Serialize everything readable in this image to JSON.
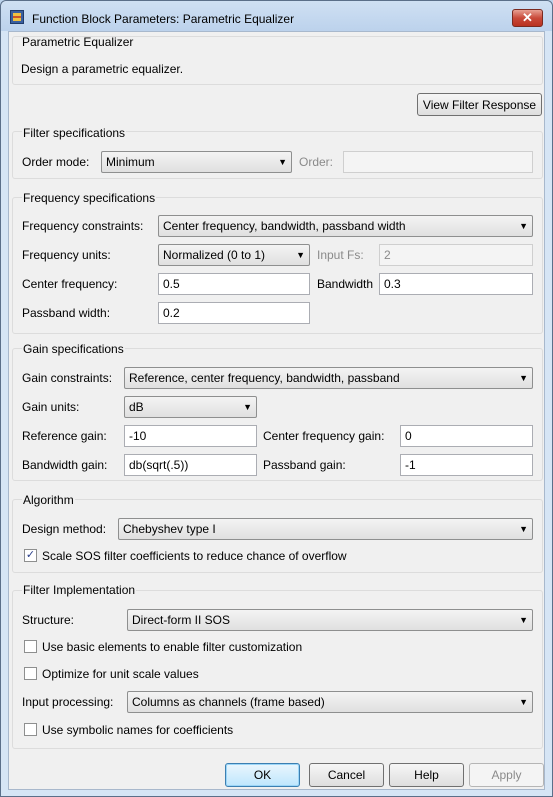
{
  "window": {
    "title": "Function Block Parameters: Parametric Equalizer",
    "close_glyph": "✕"
  },
  "block": {
    "name": "Parametric Equalizer",
    "description": "Design a parametric equalizer."
  },
  "view_button": "View Filter Response",
  "filter_specs": {
    "header": "Filter specifications",
    "order_mode_label": "Order mode:",
    "order_mode_value": "Minimum",
    "order_label": "Order:",
    "order_value": ""
  },
  "freq_specs": {
    "header": "Frequency specifications",
    "constraints_label": "Frequency constraints:",
    "constraints_value": "Center frequency, bandwidth, passband width",
    "units_label": "Frequency units:",
    "units_value": "Normalized (0 to 1)",
    "input_fs_label": "Input Fs:",
    "input_fs_value": "2",
    "center_label": "Center frequency:",
    "center_value": "0.5",
    "bandwidth_label": "Bandwidth",
    "bandwidth_value": "0.3",
    "passband_label": "Passband width:",
    "passband_value": "0.2"
  },
  "gain_specs": {
    "header": "Gain specifications",
    "constraints_label": "Gain constraints:",
    "constraints_value": "Reference, center frequency, bandwidth, passband",
    "units_label": "Gain units:",
    "units_value": "dB",
    "ref_label": "Reference gain:",
    "ref_value": "-10",
    "center_label": "Center frequency gain:",
    "center_value": "0",
    "bw_label": "Bandwidth gain:",
    "bw_value": "db(sqrt(.5))",
    "pb_label": "Passband gain:",
    "pb_value": "-1"
  },
  "algorithm": {
    "header": "Algorithm",
    "design_label": "Design method:",
    "design_value": "Chebyshev type I",
    "scale_label": "Scale SOS filter coefficients to reduce chance of overflow",
    "scale_checked": true
  },
  "implementation": {
    "header": "Filter Implementation",
    "structure_label": "Structure:",
    "structure_value": "Direct-form II SOS",
    "basic_label": "Use basic elements to enable filter customization",
    "basic_checked": false,
    "optimize_label": "Optimize for unit scale values",
    "optimize_checked": false,
    "input_label": "Input processing:",
    "input_value": "Columns as channels (frame based)",
    "symbolic_label": "Use symbolic names for coefficients",
    "symbolic_checked": false
  },
  "buttons": {
    "ok": "OK",
    "cancel": "Cancel",
    "help": "Help",
    "apply": "Apply"
  },
  "icons": {
    "dropdown": "▼",
    "check": "✓"
  }
}
